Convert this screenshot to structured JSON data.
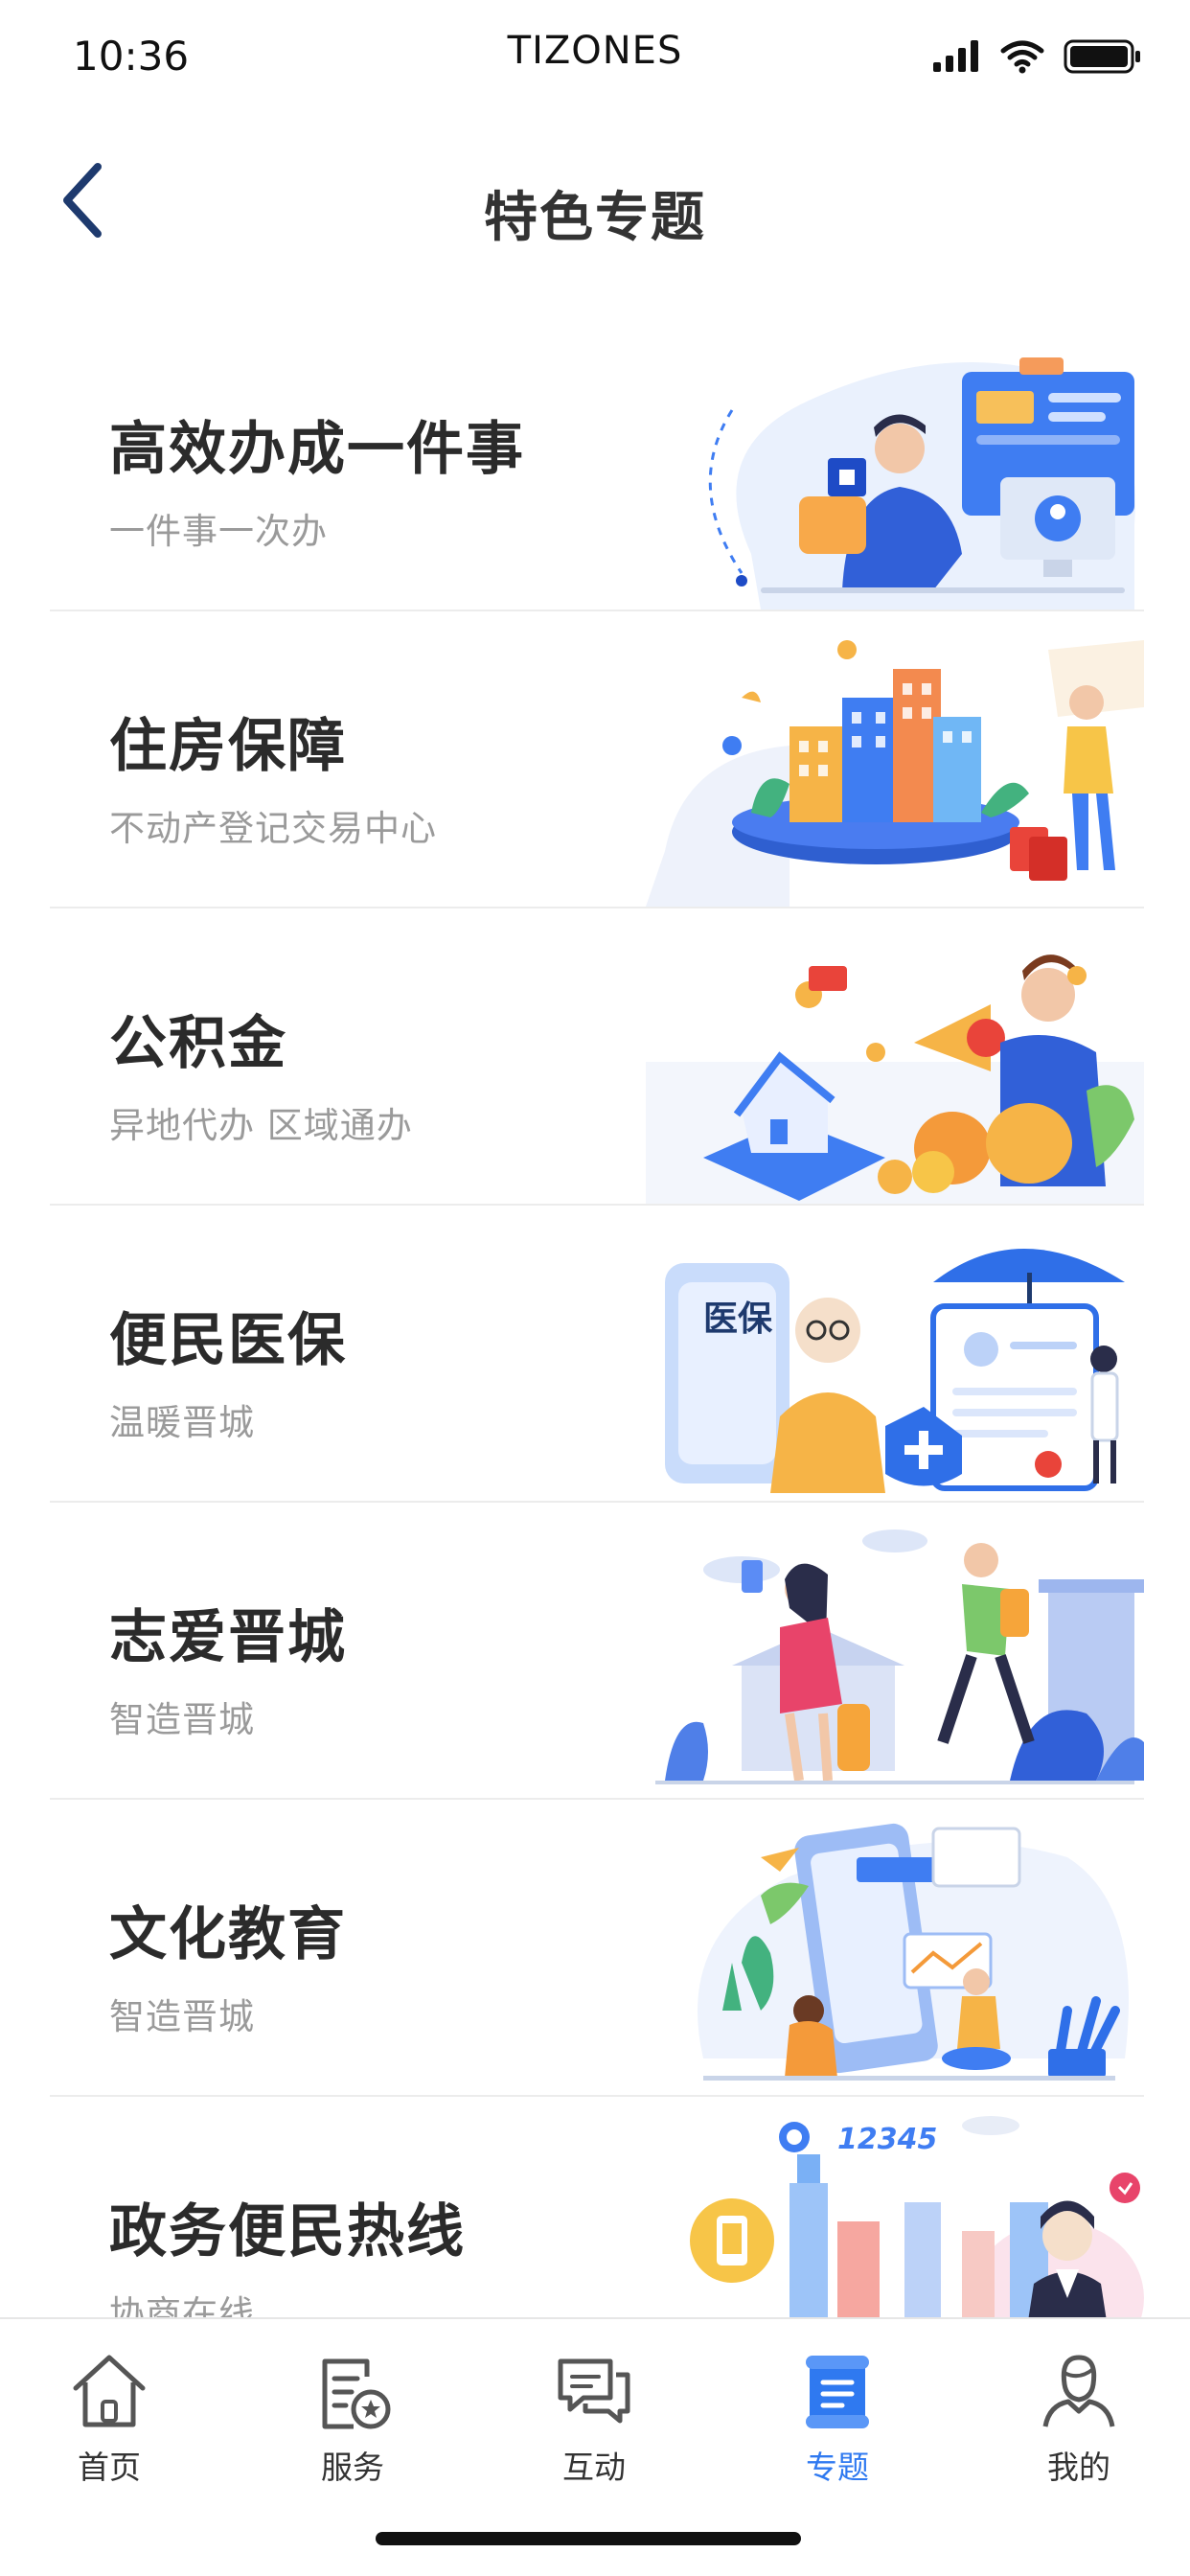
{
  "status": {
    "time": "10:36",
    "carrier": "TIZONES"
  },
  "nav": {
    "title": "特色专题"
  },
  "topics": [
    {
      "title": "高效办成一件事",
      "subtitle": "一件事一次办"
    },
    {
      "title": "住房保障",
      "subtitle": "不动产登记交易中心"
    },
    {
      "title": "公积金",
      "subtitle": "异地代办 区域通办"
    },
    {
      "title": "便民医保",
      "subtitle": "温暖晋城",
      "badge": "医保"
    },
    {
      "title": "志爱晋城",
      "subtitle": "智造晋城"
    },
    {
      "title": "文化教育",
      "subtitle": "智造晋城"
    },
    {
      "title": "政务便民热线",
      "subtitle": "协商在线",
      "badge": "12345"
    }
  ],
  "tabs": [
    {
      "label": "首页",
      "icon": "home-icon"
    },
    {
      "label": "服务",
      "icon": "service-icon"
    },
    {
      "label": "互动",
      "icon": "chat-icon"
    },
    {
      "label": "专题",
      "icon": "topic-icon",
      "active": true
    },
    {
      "label": "我的",
      "icon": "profile-icon"
    }
  ],
  "colors": {
    "accent": "#2f79f0",
    "title": "#2b2b2b",
    "subtitle": "#9a9a9a",
    "nav_icon": "#1e3a6e"
  }
}
